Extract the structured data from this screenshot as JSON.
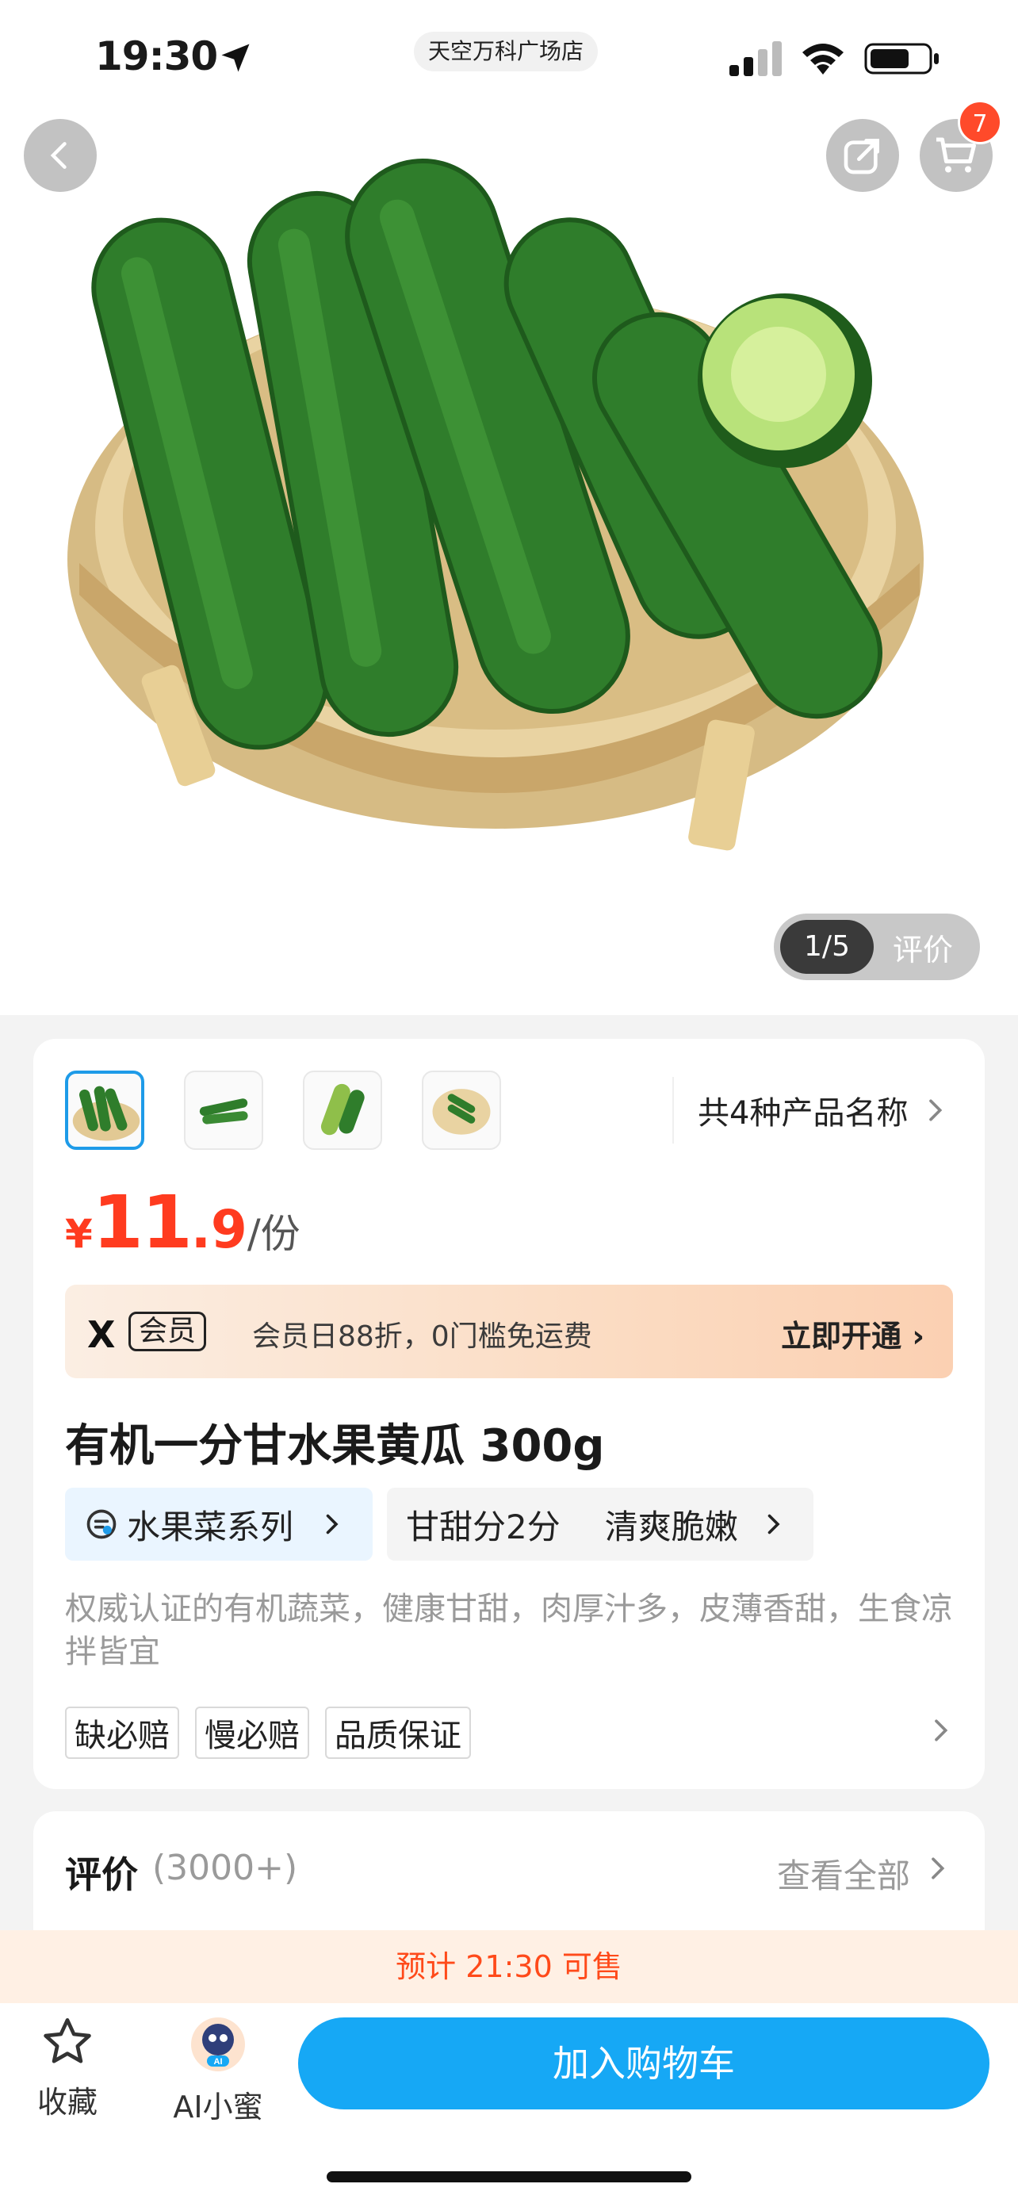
{
  "status_bar": {
    "time": "19:30",
    "store": "天空万科广场店"
  },
  "header": {
    "cart_count": "7"
  },
  "gallery": {
    "index": "1/5",
    "review_label": "评价"
  },
  "variants": {
    "summary": "共4种产品名称"
  },
  "price": {
    "currency": "¥",
    "integer": "11",
    "decimal": ".9",
    "unit": "/份"
  },
  "member": {
    "logo": "X",
    "tag": "会员",
    "text": "会员日88折，0门槛免运费",
    "cta": "立即开通"
  },
  "product": {
    "title": "有机一分甘水果黄瓜 300g",
    "series_tag": "水果菜系列",
    "taste_tags": [
      "甘甜分2分",
      "清爽脆嫩"
    ],
    "description": "权威认证的有机蔬菜，健康甘甜，肉厚汁多，皮薄香甜，生食凉拌皆宜",
    "badges": [
      "缺必赔",
      "慢必赔",
      "品质保证"
    ]
  },
  "reviews": {
    "title": "评价",
    "count": "(3000+)",
    "view_all": "查看全部"
  },
  "notice": "预计 21:30 可售",
  "bottom_bar": {
    "favorite_label": "收藏",
    "ai_badge": "AI",
    "ai_label": "AI小蜜",
    "add_to_cart": "加入购物车"
  },
  "colors": {
    "accent_blue": "#16a8f5",
    "price_red": "#ff3b1f",
    "notice_orange": "#ff4a1a"
  }
}
